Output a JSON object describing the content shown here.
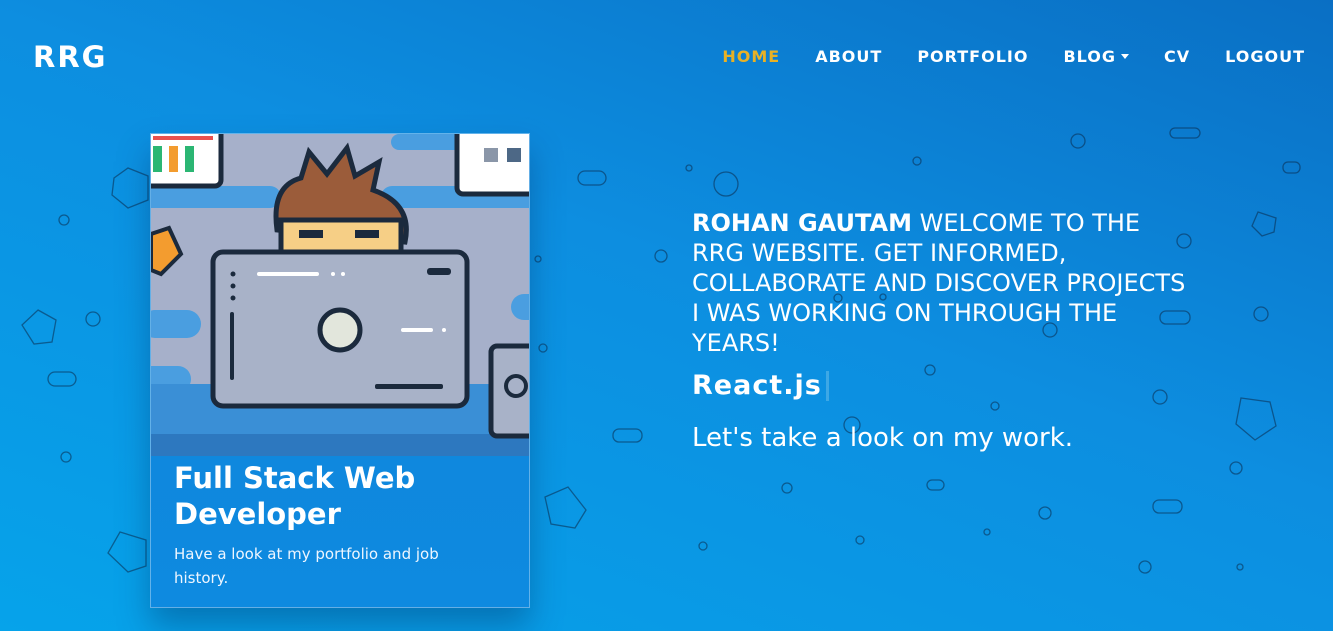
{
  "brand": "RRG",
  "nav": {
    "items": [
      {
        "label": "HOME",
        "active": true
      },
      {
        "label": "ABOUT",
        "active": false
      },
      {
        "label": "PORTFOLIO",
        "active": false
      },
      {
        "label": "BLOG",
        "active": false,
        "dropdown": true
      },
      {
        "label": "CV",
        "active": false
      },
      {
        "label": "LOGOUT",
        "active": false
      }
    ]
  },
  "card": {
    "image_icon": "developer-illustration",
    "title": "Full Stack Web Developer",
    "text": "Have a look at my portfolio and job history."
  },
  "hero": {
    "name": "ROHAN GAUTAM",
    "intro": "WELCOME TO THE RRG WEBSITE. GET INFORMED, COLLABORATE AND DISCOVER PROJECTS I WAS WORKING ON THROUGH THE YEARS!",
    "typed_text": "React.js",
    "cta": "Let's take a look on my work."
  },
  "colors": {
    "active_nav": "#e8b125",
    "background_start": "#0a6fc4",
    "background_end": "#06a3ea"
  }
}
